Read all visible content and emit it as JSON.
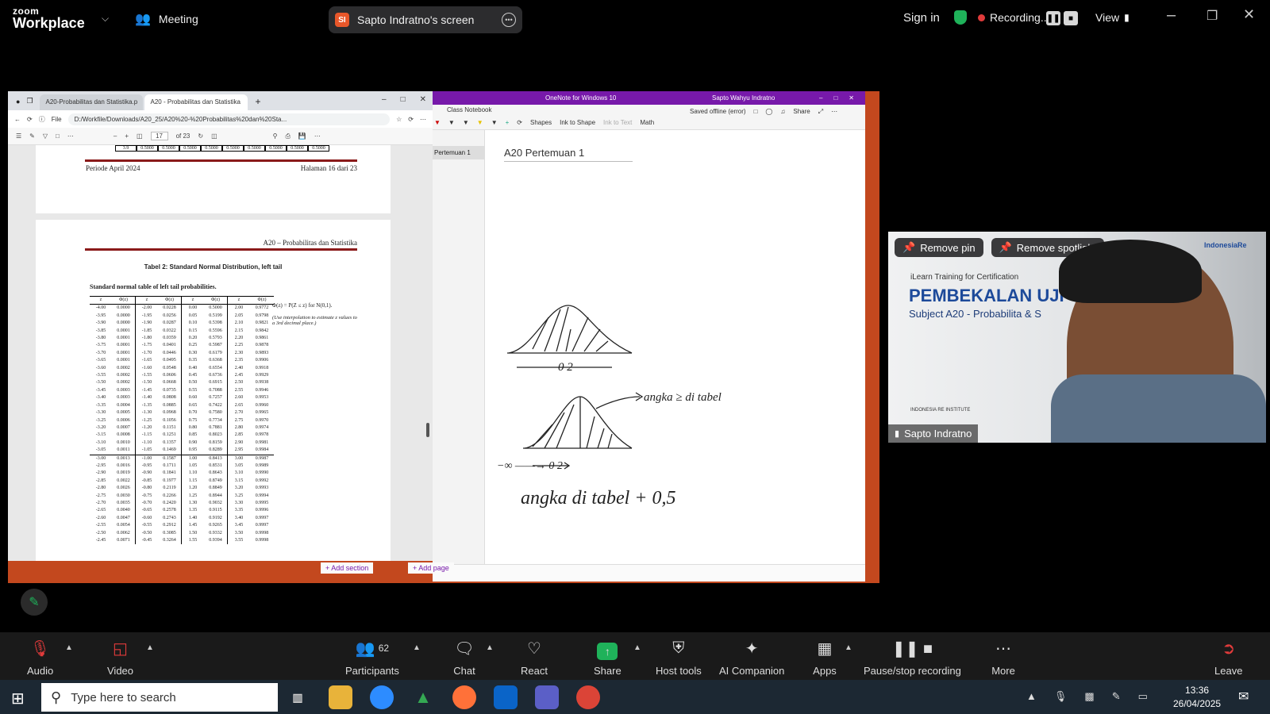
{
  "topbar": {
    "logo_line1": "zoom",
    "logo_line2": "Workplace",
    "meeting_label": "Meeting",
    "share_badge": "SI",
    "share_label": "Sapto Indratno's screen",
    "sign_in": "Sign in",
    "recording_label": "Recording...",
    "view_label": "View"
  },
  "browser": {
    "tabs": [
      "A20-Probabilitas dan Statistika.p",
      "A20 - Probabilitas dan Statistika"
    ],
    "file_label": "File",
    "url": "D:/Workfile/Downloads/A20_25/A20%20-%20Probabilitas%20dan%20Sta...",
    "page_current": "17",
    "page_total": "of 23",
    "prev_page": {
      "row": [
        "3.9",
        "0.5000",
        "0.5000",
        "0.5000",
        "0.5000",
        "0.5000",
        "0.5000",
        "0.5000",
        "0.5000",
        "0.5000"
      ],
      "footer_left": "Periode April 2024",
      "footer_right": "Halaman 16 dari 23"
    },
    "page": {
      "header_right": "A20 – Probabilitas dan Statistika",
      "table_title": "Tabel 2: Standard Normal Distribution, left tail",
      "subtitle": "Standard normal table of left tail probabilities.",
      "col_headers": [
        "z",
        "Φ(z)",
        "z",
        "Φ(z)",
        "z",
        "Φ(z)",
        "z",
        "Φ(z)"
      ],
      "formula": "Φ(z) = P(Z ≤ z) for N(0,1).",
      "note": "(Use interpolation to estimate z values to a 3rd decimal place.)",
      "rows": [
        [
          "-4.00",
          "0.0000",
          "-2.00",
          "0.0228",
          "0.00",
          "0.5000",
          "2.00",
          "0.9772"
        ],
        [
          "-3.95",
          "0.0000",
          "-1.95",
          "0.0256",
          "0.05",
          "0.5199",
          "2.05",
          "0.9798"
        ],
        [
          "-3.90",
          "0.0000",
          "-1.90",
          "0.0287",
          "0.10",
          "0.5398",
          "2.10",
          "0.9821"
        ],
        [
          "-3.85",
          "0.0001",
          "-1.85",
          "0.0322",
          "0.15",
          "0.5596",
          "2.15",
          "0.9842"
        ],
        [
          "-3.80",
          "0.0001",
          "-1.80",
          "0.0359",
          "0.20",
          "0.5793",
          "2.20",
          "0.9861"
        ],
        [
          "-3.75",
          "0.0001",
          "-1.75",
          "0.0401",
          "0.25",
          "0.5987",
          "2.25",
          "0.9878"
        ],
        [
          "-3.70",
          "0.0001",
          "-1.70",
          "0.0446",
          "0.30",
          "0.6179",
          "2.30",
          "0.9893"
        ],
        [
          "-3.65",
          "0.0001",
          "-1.65",
          "0.0495",
          "0.35",
          "0.6368",
          "2.35",
          "0.9906"
        ],
        [
          "-3.60",
          "0.0002",
          "-1.60",
          "0.0548",
          "0.40",
          "0.6554",
          "2.40",
          "0.9918"
        ],
        [
          "-3.55",
          "0.0002",
          "-1.55",
          "0.0606",
          "0.45",
          "0.6736",
          "2.45",
          "0.9929"
        ],
        [
          "-3.50",
          "0.0002",
          "-1.50",
          "0.0668",
          "0.50",
          "0.6915",
          "2.50",
          "0.9938"
        ],
        [
          "-3.45",
          "0.0003",
          "-1.45",
          "0.0735",
          "0.55",
          "0.7088",
          "2.55",
          "0.9946"
        ],
        [
          "-3.40",
          "0.0003",
          "-1.40",
          "0.0808",
          "0.60",
          "0.7257",
          "2.60",
          "0.9953"
        ],
        [
          "-3.35",
          "0.0004",
          "-1.35",
          "0.0885",
          "0.65",
          "0.7422",
          "2.65",
          "0.9960"
        ],
        [
          "-3.30",
          "0.0005",
          "-1.30",
          "0.0968",
          "0.70",
          "0.7580",
          "2.70",
          "0.9965"
        ],
        [
          "-3.25",
          "0.0006",
          "-1.25",
          "0.1056",
          "0.75",
          "0.7734",
          "2.75",
          "0.9970"
        ],
        [
          "-3.20",
          "0.0007",
          "-1.20",
          "0.1151",
          "0.80",
          "0.7881",
          "2.80",
          "0.9974"
        ],
        [
          "-3.15",
          "0.0008",
          "-1.15",
          "0.1251",
          "0.85",
          "0.8023",
          "2.85",
          "0.9978"
        ],
        [
          "-3.10",
          "0.0010",
          "-1.10",
          "0.1357",
          "0.90",
          "0.8159",
          "2.90",
          "0.9981"
        ],
        [
          "-3.05",
          "0.0011",
          "-1.05",
          "0.1469",
          "0.95",
          "0.8289",
          "2.95",
          "0.9984"
        ],
        [
          "-3.00",
          "0.0013",
          "-1.00",
          "0.1587",
          "1.00",
          "0.8413",
          "3.00",
          "0.9987"
        ],
        [
          "-2.95",
          "0.0016",
          "-0.95",
          "0.1711",
          "1.05",
          "0.8531",
          "3.05",
          "0.9989"
        ],
        [
          "-2.90",
          "0.0019",
          "-0.90",
          "0.1841",
          "1.10",
          "0.8643",
          "3.10",
          "0.9990"
        ],
        [
          "-2.85",
          "0.0022",
          "-0.85",
          "0.1977",
          "1.15",
          "0.8749",
          "3.15",
          "0.9992"
        ],
        [
          "-2.80",
          "0.0026",
          "-0.80",
          "0.2119",
          "1.20",
          "0.8849",
          "3.20",
          "0.9993"
        ],
        [
          "-2.75",
          "0.0030",
          "-0.75",
          "0.2266",
          "1.25",
          "0.8944",
          "3.25",
          "0.9994"
        ],
        [
          "-2.70",
          "0.0035",
          "-0.70",
          "0.2420",
          "1.30",
          "0.9032",
          "3.30",
          "0.9995"
        ],
        [
          "-2.65",
          "0.0040",
          "-0.65",
          "0.2578",
          "1.35",
          "0.9115",
          "3.35",
          "0.9996"
        ],
        [
          "-2.60",
          "0.0047",
          "-0.60",
          "0.2743",
          "1.40",
          "0.9192",
          "3.40",
          "0.9997"
        ],
        [
          "-2.55",
          "0.0054",
          "-0.55",
          "0.2912",
          "1.45",
          "0.9265",
          "3.45",
          "0.9997"
        ],
        [
          "-2.50",
          "0.0062",
          "-0.50",
          "0.3085",
          "1.50",
          "0.9332",
          "3.50",
          "0.9998"
        ],
        [
          "-2.45",
          "0.0071",
          "-0.45",
          "0.3264",
          "1.55",
          "0.9394",
          "3.55",
          "0.9998"
        ]
      ]
    }
  },
  "onenote": {
    "title": "OneNote for Windows 10",
    "user": "Sapto Wahyu Indratno",
    "notebook": "Class Notebook",
    "status": "Saved offline (error)",
    "share": "Share",
    "ribbon": [
      "Shapes",
      "Ink to Shape",
      "Ink to Text",
      "Math"
    ],
    "section": "Pertemuan 1",
    "page_title": "A20 Pertemuan 1",
    "add_section": "Add section",
    "add_page": "Add page",
    "ink": {
      "axis1": "0        2",
      "note_top": "angka ≥ di tabel",
      "axis2": "−∞ ——→ 0     2",
      "note_bottom": "angka di tabel + 0,5"
    }
  },
  "video": {
    "remove_pin": "Remove pin",
    "remove_spotlight": "Remove spotlight",
    "slide_kicker": "iLearn Training for Certification",
    "slide_title": "PEMBEKALAN UJI",
    "slide_subtitle": "Subject A20 - Probabilita & S",
    "brand": "IndonesiaRe",
    "institute": "INDONESIA RE INSTITUTE",
    "participant": "Sapto Indratno"
  },
  "toolbar": {
    "audio": "Audio",
    "video": "Video",
    "participants": "Participants",
    "participants_count": "62",
    "chat": "Chat",
    "react": "React",
    "share": "Share",
    "host_tools": "Host tools",
    "ai_companion": "AI Companion",
    "apps": "Apps",
    "pause_recording": "Pause/stop recording",
    "more": "More",
    "leave": "Leave"
  },
  "taskbar": {
    "search_placeholder": "Type here to search",
    "time": "13:36",
    "date": "26/04/2025"
  },
  "colors": {
    "zoom_bg": "#000000",
    "onenote_purple": "#7719aa",
    "share_green": "#1fb25a",
    "record_red": "#e03b3b",
    "taskbar": "#1c2833"
  }
}
